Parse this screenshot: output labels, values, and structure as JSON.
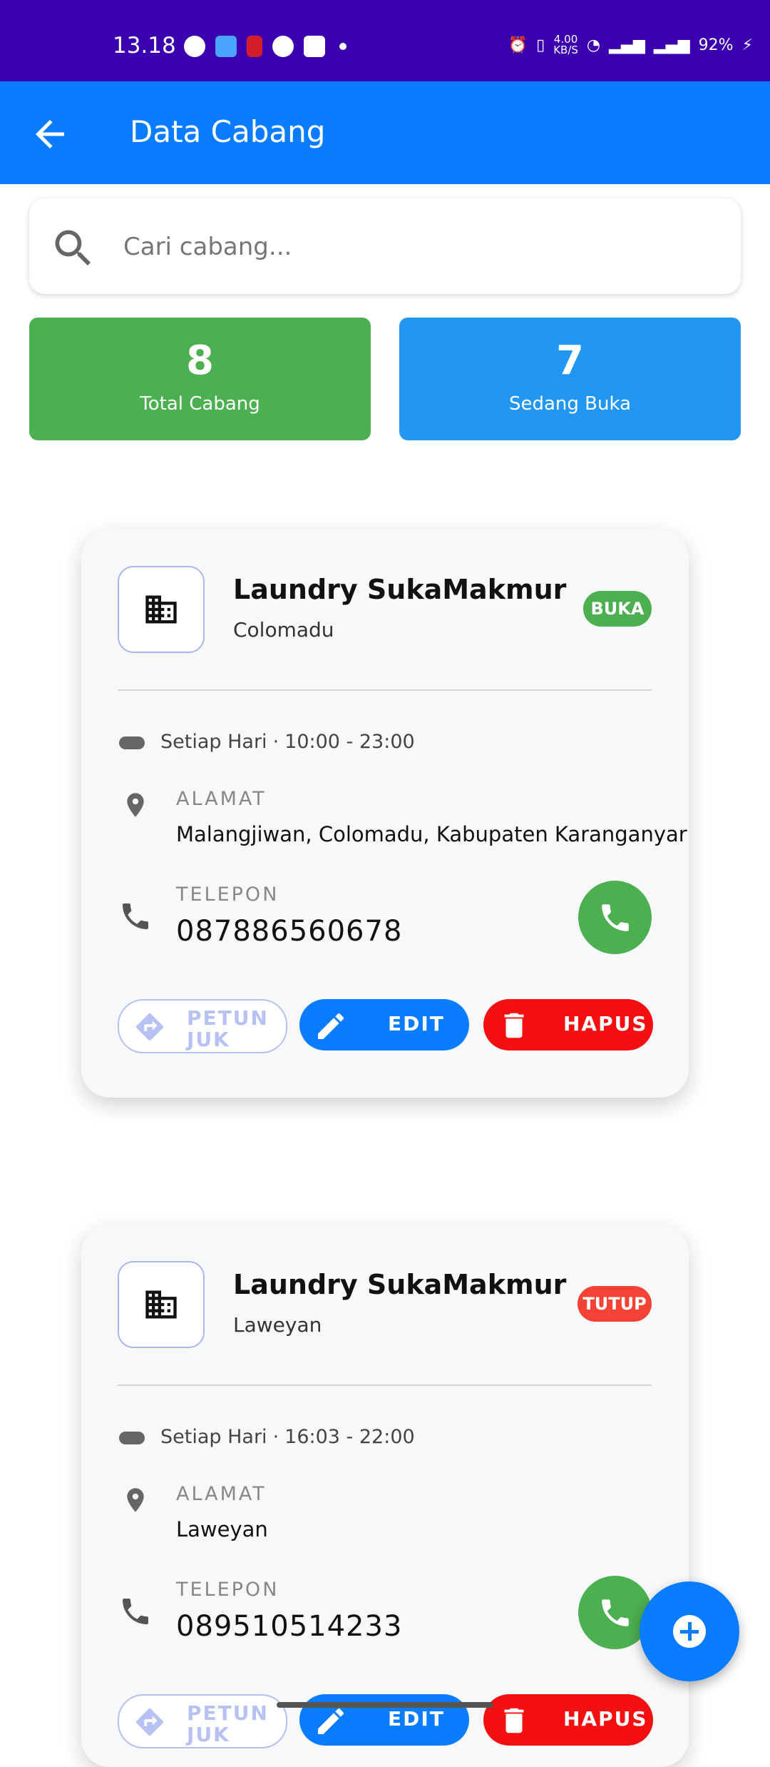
{
  "status_bar": {
    "time": "13.18",
    "net_speed": "4.00",
    "net_unit": "KB/S",
    "battery": "92%"
  },
  "app_bar": {
    "title": "Data Cabang",
    "back_icon": "arrow-left-icon"
  },
  "search": {
    "placeholder": "Cari cabang...",
    "value": ""
  },
  "stats": [
    {
      "value": "8",
      "label": "Total Cabang",
      "color": "#4caf50"
    },
    {
      "value": "7",
      "label": "Sedang Buka",
      "color": "#2196f3"
    }
  ],
  "labels": {
    "address": "ALAMAT",
    "phone": "TELEPON",
    "directions": "PETUNJUK",
    "edit": "EDIT",
    "delete": "HAPUS"
  },
  "branches": [
    {
      "name": "Laundry SukaMakmur",
      "area": "Colomadu",
      "status": "BUKA",
      "status_color": "#4caf50",
      "days": "Setiap Hari",
      "hours": "10:00 - 23:00",
      "address": "Malangjiwan, Colomadu, Kabupaten Karanganyar",
      "phone": "087886560678"
    },
    {
      "name": "Laundry SukaMakmur",
      "area": "Laweyan",
      "status": "TUTUP",
      "status_color": "#f44336",
      "days": "Setiap Hari",
      "hours": "16:03 - 22:00",
      "address": "Laweyan",
      "phone": "089510514233"
    }
  ],
  "fab": {
    "icon": "add-icon"
  },
  "colors": {
    "status_bar": "#3a00b0",
    "primary": "#0a7cff",
    "delete": "#f41010"
  }
}
